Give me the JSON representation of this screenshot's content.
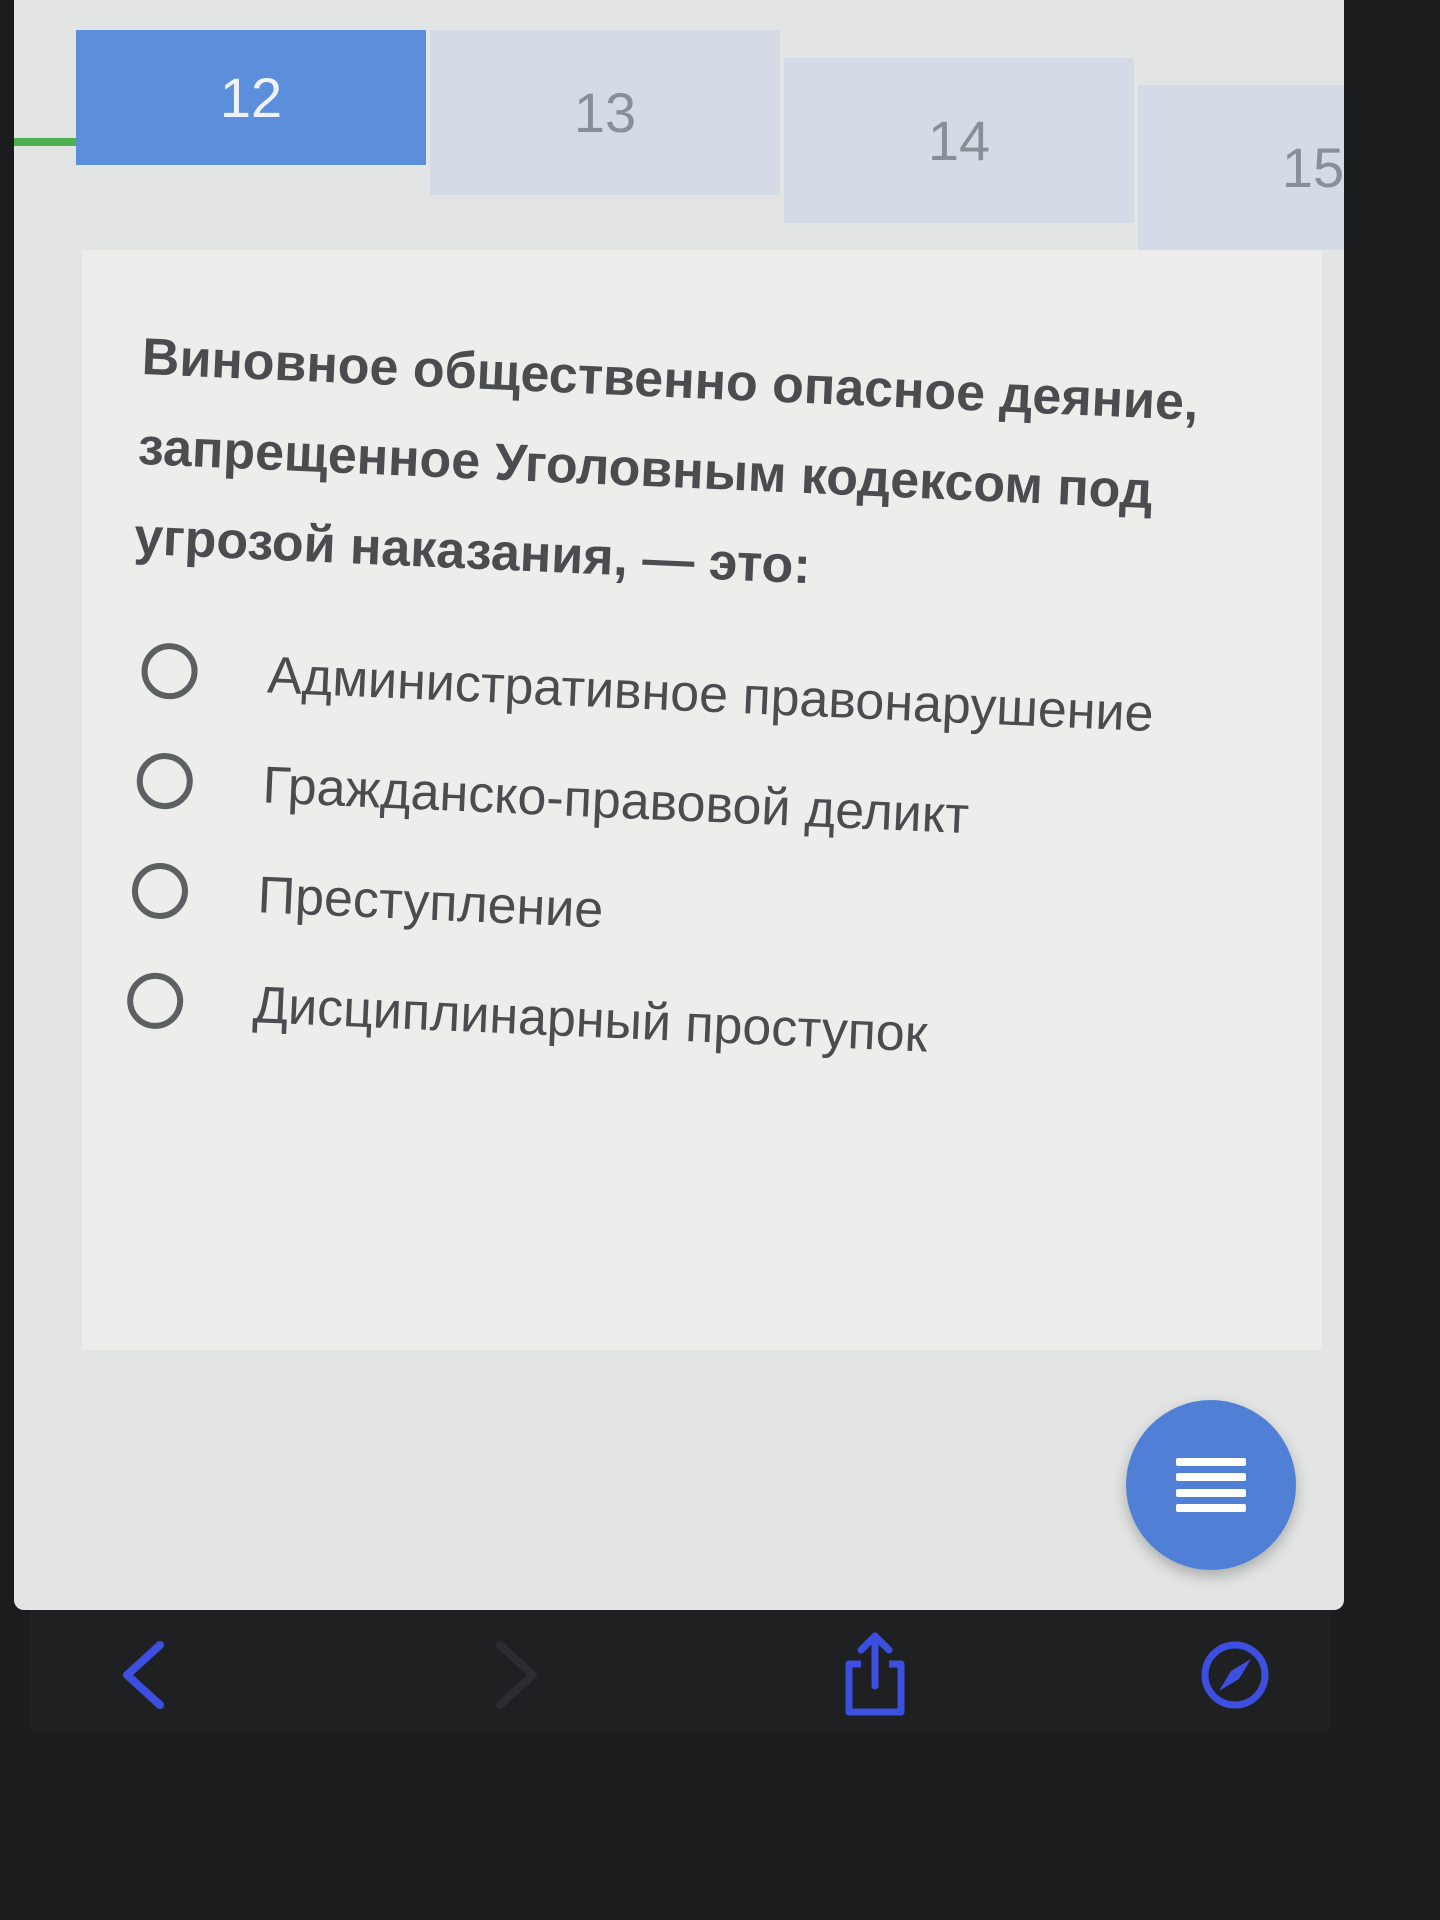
{
  "tabs": [
    {
      "label": "12",
      "active": true
    },
    {
      "label": "13",
      "active": false
    },
    {
      "label": "14",
      "active": false
    },
    {
      "label": "15",
      "active": false
    }
  ],
  "question": {
    "text": "Виновное общественно опасное деяние, запрещенное Уголовным кодексом под угрозой наказания, — это:"
  },
  "options": [
    {
      "label": "Административное правонарушение"
    },
    {
      "label": "Гражданско-правовой деликт"
    },
    {
      "label": "Преступление"
    },
    {
      "label": "Дисциплинарный проступок"
    }
  ],
  "fab": {
    "icon": "menu-icon"
  },
  "browser_bar": {
    "icons": [
      "back-icon",
      "forward-icon",
      "share-icon",
      "compass-icon"
    ],
    "accent_color": "#3d4fe0"
  },
  "colors": {
    "tab_active": "#5b8fdc",
    "tab_inactive": "#d5dbe6",
    "progress": "#4caf50",
    "fab": "#4f80d6"
  }
}
